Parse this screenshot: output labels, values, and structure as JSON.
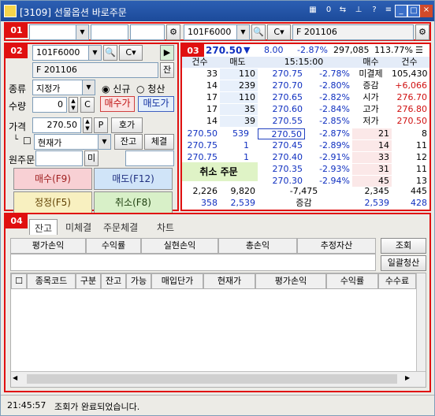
{
  "title": "[3109] 선물옵션 바로주문",
  "toolbar_top": {
    "left_code": "",
    "right_code": "101F6000",
    "right_name": "F 201106"
  },
  "order_panel": {
    "code": "101F6000",
    "name": "F 201106",
    "balance_btn": "잔",
    "type_label": "종류",
    "type_value": "지정가",
    "new_label": "신규",
    "close_label": "청산",
    "qty_label": "수량",
    "qty_value": "0",
    "c_btn": "C",
    "buy_qty_btn": "매수가",
    "sell_qty_btn": "매도가",
    "price_label": "가격",
    "price_value": "270.50",
    "p_btn": "P",
    "quote_btn": "호가",
    "current_label": "현재가",
    "balance2_btn": "잔고",
    "exec_btn": "체결",
    "orig_label": "원주문",
    "mi_btn": "미",
    "buy_btn": "매수(F9)",
    "sell_btn": "매도(F12)",
    "modify_btn": "정정(F5)",
    "cancel_btn": "취소(F8)"
  },
  "quote_panel": {
    "price": "270.50",
    "change": "8.00",
    "rate": "-2.87%",
    "volume": "297,085",
    "ratio": "113.77%",
    "headers": [
      "건수",
      "매도",
      "15:15:00",
      "매수",
      "건수"
    ],
    "asks": [
      {
        "cnt": "33",
        "qty": "110",
        "price": "270.75",
        "rate": "-2.78%",
        "label": "미결제",
        "lval": "105,430"
      },
      {
        "cnt": "14",
        "qty": "239",
        "price": "270.70",
        "rate": "-2.80%",
        "label": "증감",
        "lval": "+6,066"
      },
      {
        "cnt": "17",
        "qty": "110",
        "price": "270.65",
        "rate": "-2.82%",
        "label": "시가",
        "lval": "276.70"
      },
      {
        "cnt": "17",
        "qty": "35",
        "price": "270.60",
        "rate": "-2.84%",
        "label": "고가",
        "lval": "276.80"
      },
      {
        "cnt": "14",
        "qty": "39",
        "price": "270.55",
        "rate": "-2.85%",
        "label": "저가",
        "lval": "270.50"
      }
    ],
    "trades": [
      {
        "price": "270.50",
        "qty": "539"
      },
      {
        "price": "270.75",
        "qty": "1"
      },
      {
        "price": "270.75",
        "qty": "1"
      }
    ],
    "bids": [
      {
        "price": "270.50",
        "rate": "-2.87%",
        "qty": "21",
        "cnt": "8"
      },
      {
        "price": "270.45",
        "rate": "-2.89%",
        "qty": "14",
        "cnt": "11"
      },
      {
        "price": "270.40",
        "rate": "-2.91%",
        "qty": "33",
        "cnt": "12"
      },
      {
        "price": "270.35",
        "rate": "-2.93%",
        "qty": "31",
        "cnt": "11"
      },
      {
        "price": "270.30",
        "rate": "-2.94%",
        "qty": "45",
        "cnt": "13"
      }
    ],
    "cancel_order_btn": "취소 주문",
    "totals": {
      "cnt_sell": "2,226",
      "qty_sell": "9,820",
      "diff": "-7,475",
      "qty_buy": "2,345",
      "cnt_buy": "445"
    },
    "totals2": {
      "cnt_sell": "358",
      "qty_sell": "2,539",
      "label": "증감",
      "qty_buy": "2,539",
      "cnt_buy": "428"
    }
  },
  "bottom": {
    "tabs": [
      "잔고",
      "미체결",
      "주문체결",
      "차트"
    ],
    "summary_headers": [
      "평가손익",
      "수익률",
      "실현손익",
      "총손익",
      "추정자산"
    ],
    "query_btn": "조회",
    "bulk_close_btn": "일괄청산",
    "table_headers": [
      "종목코드",
      "구분",
      "잔고",
      "가능",
      "매입단가",
      "현재가",
      "평가손익",
      "수익률",
      "수수료"
    ]
  },
  "status": {
    "time": "21:45:57",
    "message": "조회가 완료되었습니다."
  },
  "section_badges": [
    "01",
    "02",
    "03",
    "04"
  ]
}
